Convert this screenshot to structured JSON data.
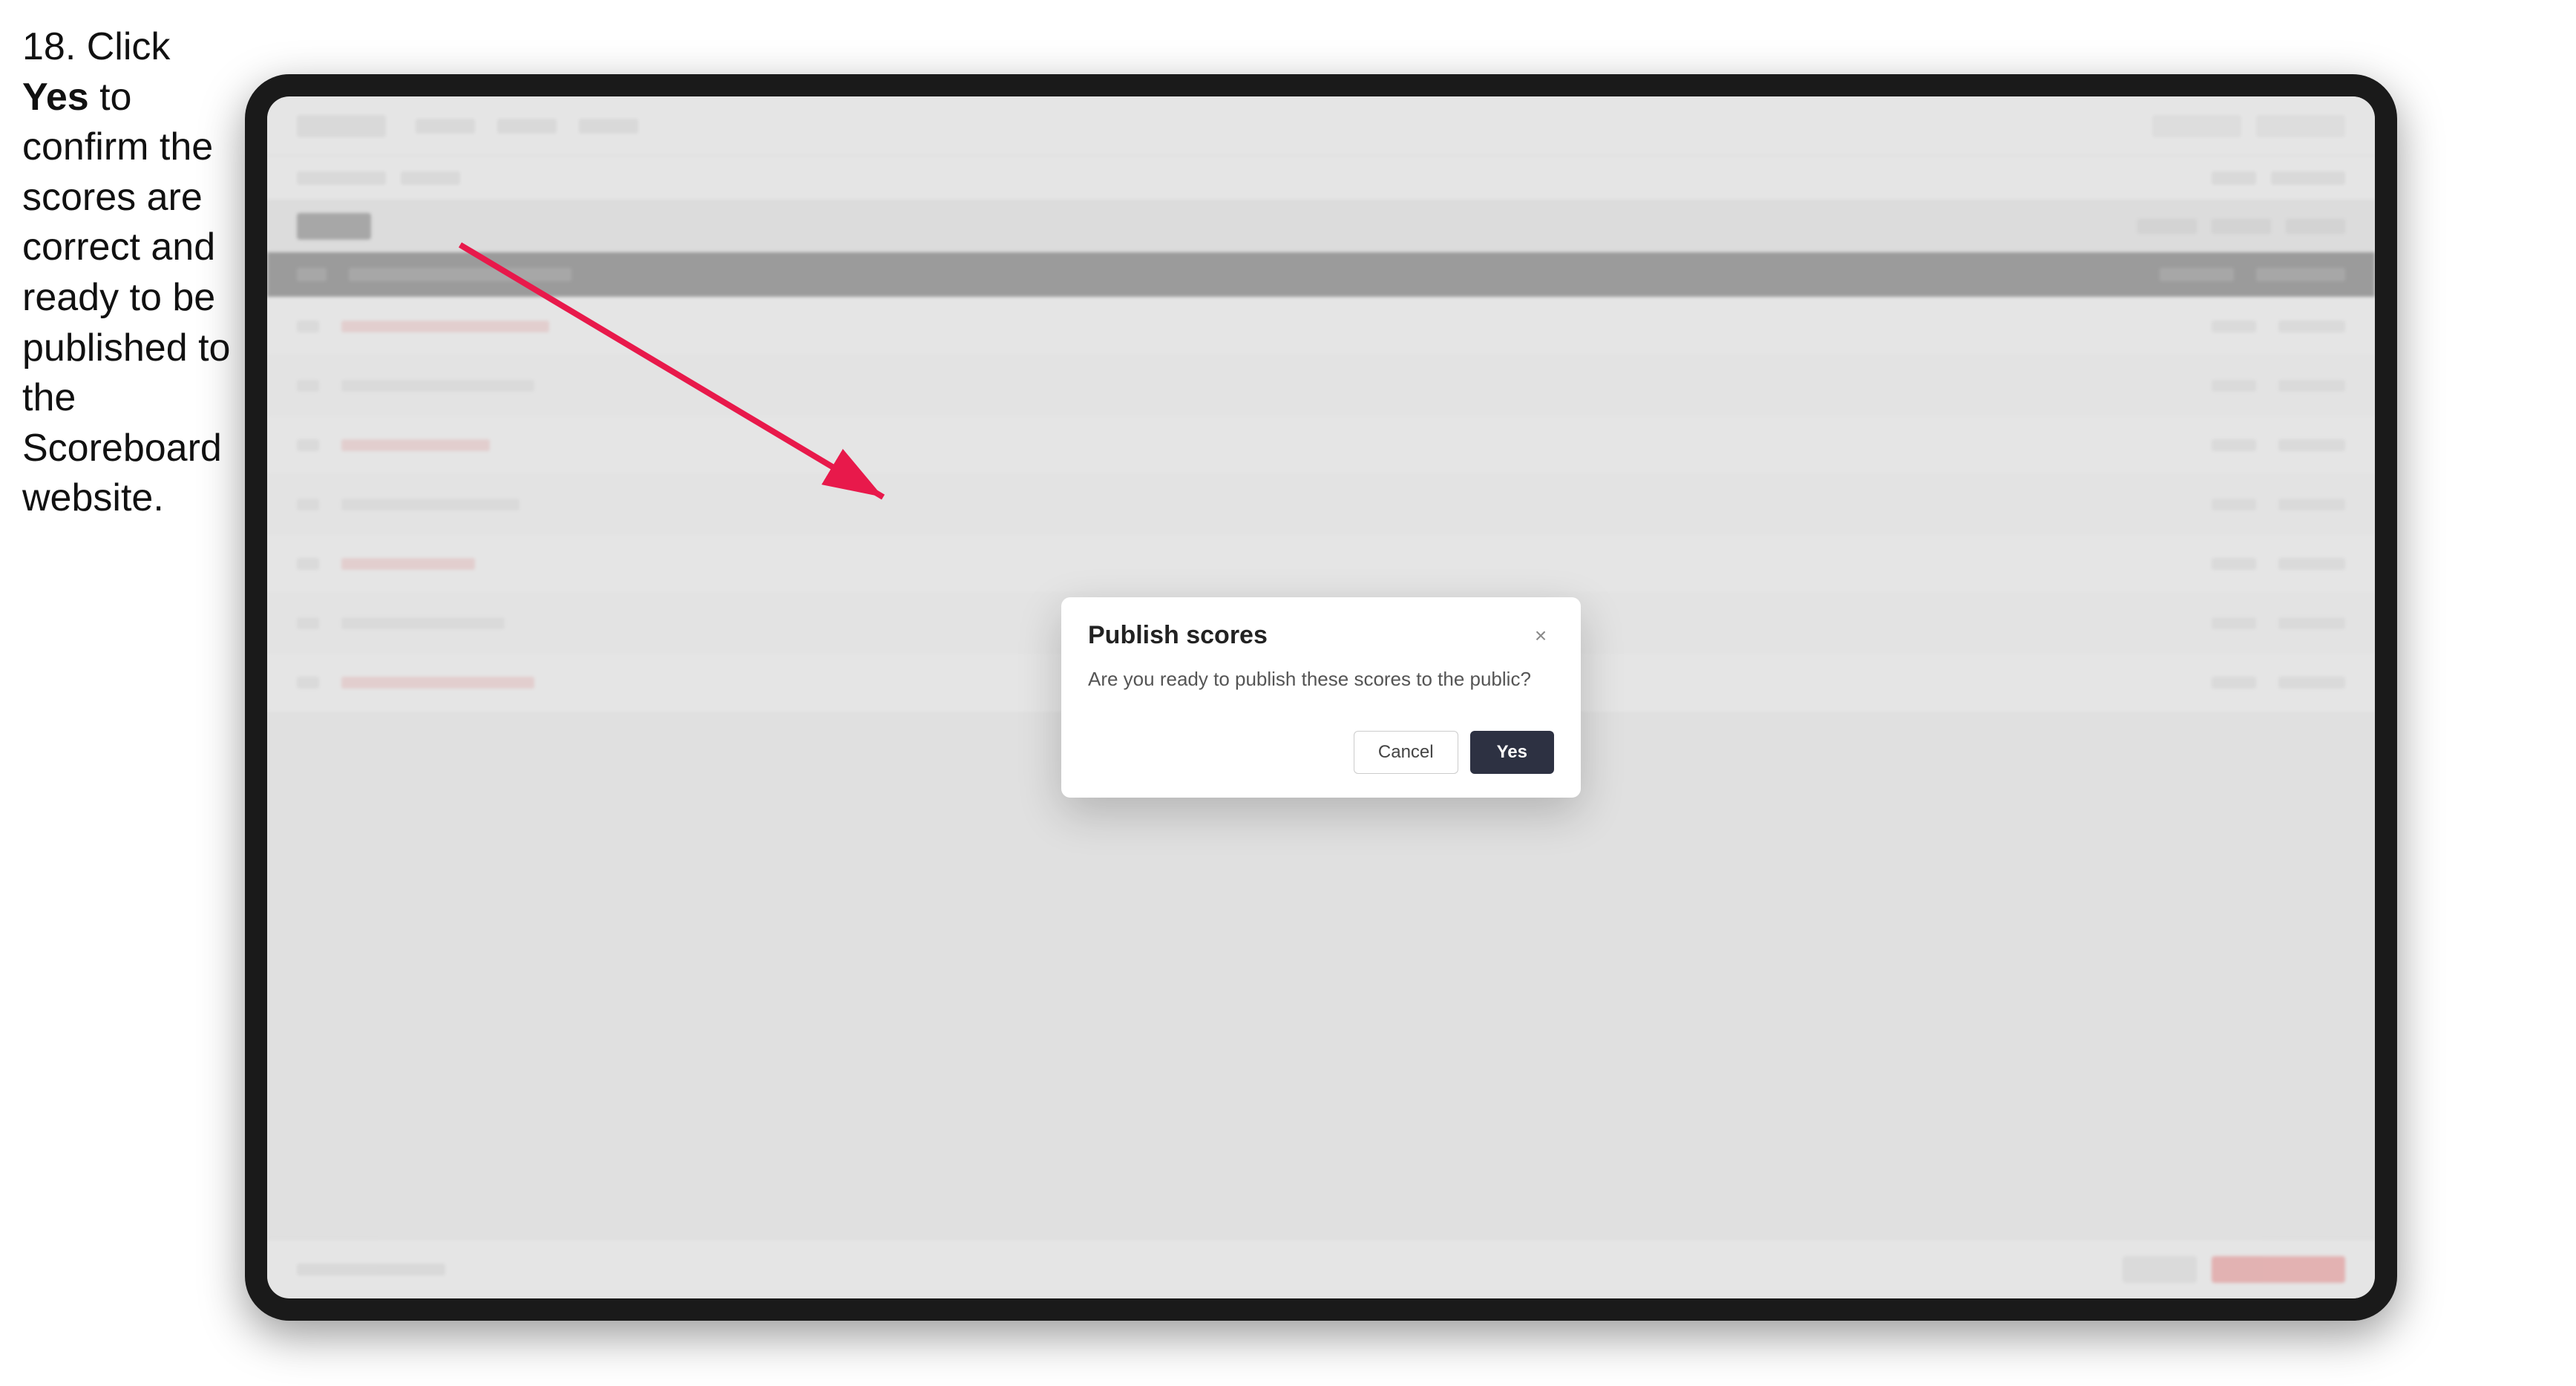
{
  "instruction": {
    "step_number": "18.",
    "text_part1": " Click ",
    "text_bold": "Yes",
    "text_part2": " to confirm the scores are correct and ready to be published to the Scoreboard website."
  },
  "modal": {
    "title": "Publish scores",
    "message": "Are you ready to publish these scores to the public?",
    "close_icon": "×",
    "cancel_label": "Cancel",
    "yes_label": "Yes"
  },
  "arrow": {
    "color": "#e8194b"
  }
}
